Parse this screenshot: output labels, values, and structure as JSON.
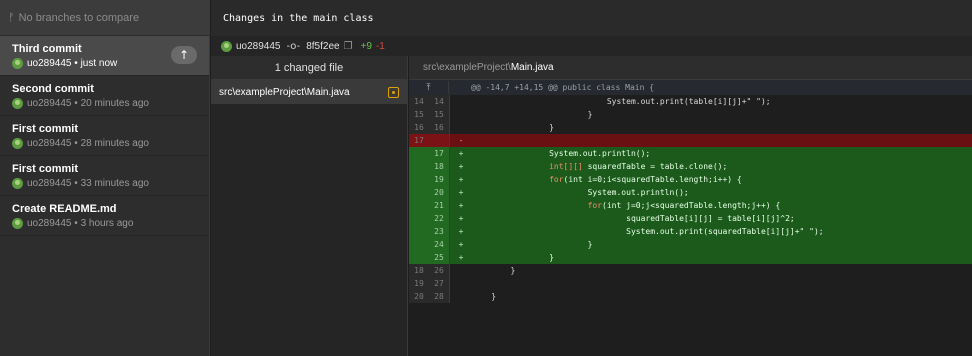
{
  "sidebar": {
    "branch_filter": {
      "icon": "branch-icon",
      "placeholder": "No branches to compare"
    },
    "commits": [
      {
        "title": "Third commit",
        "author": "uo289445",
        "time": "just now",
        "selected": true
      },
      {
        "title": "Second commit",
        "author": "uo289445",
        "time": "20 minutes ago"
      },
      {
        "title": "First commit",
        "author": "uo289445",
        "time": "28 minutes ago"
      },
      {
        "title": "First commit",
        "author": "uo289445",
        "time": "33 minutes ago"
      },
      {
        "title": "Create README.md",
        "author": "uo289445",
        "time": "3 hours ago"
      }
    ],
    "push_icon": "arrow-up-icon"
  },
  "header": {
    "title": "Changes in the main class"
  },
  "commit_meta": {
    "author": "uo289445",
    "sha": "8f5f2ee",
    "additions": "+9",
    "deletions": "-1"
  },
  "files": {
    "header": "1 changed file",
    "items": [
      {
        "name": "src\\exampleProject\\Main.java"
      }
    ]
  },
  "diff": {
    "path_prefix": "src\\exampleProject\\",
    "path_file": "Main.java",
    "hunk_header": "@@ -14,7 +14,15 @@ public class Main {",
    "lines": [
      {
        "type": "ctx",
        "old": "14",
        "new": "14",
        "marker": "",
        "code": "                            System.out.print(table[i][j]+\" \");"
      },
      {
        "type": "ctx",
        "old": "15",
        "new": "15",
        "marker": "",
        "code": "                        }"
      },
      {
        "type": "ctx",
        "old": "16",
        "new": "16",
        "marker": "",
        "code": "                }"
      },
      {
        "type": "del",
        "old": "17",
        "new": "",
        "marker": "-",
        "code": ""
      },
      {
        "type": "add",
        "old": "",
        "new": "17",
        "marker": "+",
        "code": "                System.out.println();"
      },
      {
        "type": "add",
        "old": "",
        "new": "18",
        "marker": "+",
        "code": "                int[][] squaredTable = table.clone();"
      },
      {
        "type": "add",
        "old": "",
        "new": "19",
        "marker": "+",
        "code": "                for(int i=0;i<squaredTable.length;i++) {"
      },
      {
        "type": "add",
        "old": "",
        "new": "20",
        "marker": "+",
        "code": "                        System.out.println();"
      },
      {
        "type": "add",
        "old": "",
        "new": "21",
        "marker": "+",
        "code": "                        for(int j=0;j<squaredTable.length;j++) {"
      },
      {
        "type": "add",
        "old": "",
        "new": "22",
        "marker": "+",
        "code": "                                squaredTable[i][j] = table[i][j]^2;"
      },
      {
        "type": "add",
        "old": "",
        "new": "23",
        "marker": "+",
        "code": "                                System.out.print(squaredTable[i][j]+\" \");"
      },
      {
        "type": "add",
        "old": "",
        "new": "24",
        "marker": "+",
        "code": "                        }"
      },
      {
        "type": "add",
        "old": "",
        "new": "25",
        "marker": "+",
        "code": "                }"
      },
      {
        "type": "ctx",
        "old": "18",
        "new": "26",
        "marker": "",
        "code": "        }"
      },
      {
        "type": "ctx",
        "old": "19",
        "new": "27",
        "marker": "",
        "code": ""
      },
      {
        "type": "ctx",
        "old": "20",
        "new": "28",
        "marker": "",
        "code": "    }"
      }
    ]
  },
  "colors": {
    "added_bg": "#1c5a1c",
    "deleted_bg": "#6a0f12",
    "additions": "#6cbf4a",
    "deletions": "#d24b4b"
  }
}
